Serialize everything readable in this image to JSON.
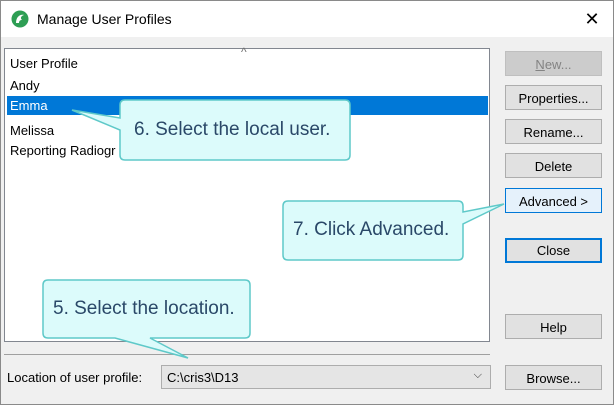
{
  "window": {
    "title": "Manage User Profiles",
    "icon": "dragon-naturallyspeaking-icon",
    "close_glyph": "✕"
  },
  "list": {
    "header": "User Profile",
    "sort_glyph": "^",
    "items": [
      {
        "label": "Andy",
        "selected": false
      },
      {
        "label": "Emma",
        "selected": true
      },
      {
        "label": "Melissa",
        "selected": false
      },
      {
        "label": "Reporting Radiogr",
        "selected": false
      }
    ]
  },
  "buttons": {
    "new": "New...",
    "properties": "Properties...",
    "rename": "Rename...",
    "delete": "Delete",
    "advanced": "Advanced >",
    "close": "Close",
    "help": "Help",
    "browse": "Browse..."
  },
  "location": {
    "label": "Location of user profile:",
    "value": "C:\\cris3\\D13",
    "dropdown_glyph": "⌵"
  },
  "callouts": {
    "step6": "6. Select the local user.",
    "step7": "7. Click Advanced.",
    "step5": "5. Select the location."
  },
  "colors": {
    "selection": "#0078d7",
    "callout_fill": "#dcfbfb",
    "callout_border": "#5fc9c9",
    "callout_text": "#2a4868"
  }
}
